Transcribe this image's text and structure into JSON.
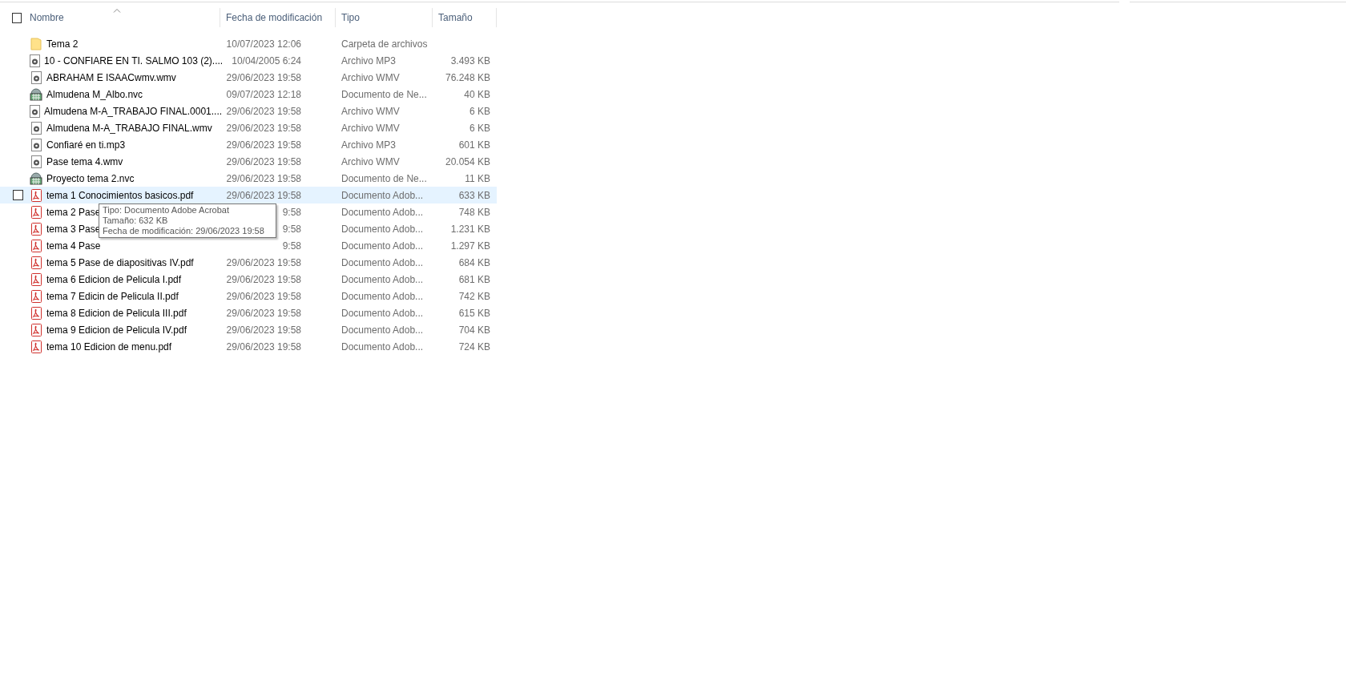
{
  "select_all": {
    "checked": false
  },
  "columns": [
    {
      "label": "Nombre",
      "sorted": true
    },
    {
      "label": "Fecha de modificación",
      "sorted": false
    },
    {
      "label": "Tipo",
      "sorted": false
    },
    {
      "label": "Tamaño",
      "sorted": false
    }
  ],
  "rows": [
    {
      "kind": "folder",
      "name": "Tema 2",
      "date": "10/07/2023 12:06",
      "type": "Carpeta de archivos",
      "hovered": false,
      "checked": false
    },
    {
      "kind": "media",
      "name": "10 - CONFIARE EN TI. SALMO 103 (2)....",
      "date": "10/04/2005 6:24",
      "type": "Archivo MP3",
      "size": "3.493 KB",
      "hovered": false,
      "checked": false
    },
    {
      "kind": "media",
      "name": "ABRAHAM E ISAACwmv.wmv",
      "date": "29/06/2023 19:58",
      "type": "Archivo WMV",
      "size": "76.248 KB",
      "hovered": false,
      "checked": false
    },
    {
      "kind": "project",
      "name": "Almudena M_Albo.nvc",
      "date": "09/07/2023 12:18",
      "type": "Documento de Ne...",
      "size": "40 KB",
      "hovered": false,
      "checked": false
    },
    {
      "kind": "media",
      "name": "Almudena M-A_TRABAJO FINAL.0001....",
      "date": "29/06/2023 19:58",
      "type": "Archivo WMV",
      "size": "6 KB",
      "hovered": false,
      "checked": false
    },
    {
      "kind": "media",
      "name": "Almudena M-A_TRABAJO FINAL.wmv",
      "date": "29/06/2023 19:58",
      "type": "Archivo WMV",
      "size": "6 KB",
      "hovered": false,
      "checked": false
    },
    {
      "kind": "media",
      "name": "Confiaré en ti.mp3",
      "date": "29/06/2023 19:58",
      "type": "Archivo MP3",
      "size": "601 KB",
      "hovered": false,
      "checked": false
    },
    {
      "kind": "media",
      "name": "Pase tema 4.wmv",
      "date": "29/06/2023 19:58",
      "type": "Archivo WMV",
      "size": "20.054 KB",
      "hovered": false,
      "checked": false
    },
    {
      "kind": "project",
      "name": "Proyecto tema 2.nvc",
      "date": "29/06/2023 19:58",
      "type": "Documento de Ne...",
      "size": "11 KB",
      "hovered": false,
      "checked": false
    },
    {
      "kind": "pdf",
      "name": "tema 1 Conocimientos basicos.pdf",
      "date": "29/06/2023 19:58",
      "type": "Documento Adob...",
      "size": "633 KB",
      "hovered": true,
      "checked": false
    },
    {
      "kind": "pdf",
      "name": "tema 2 Pase",
      "date": "9:58",
      "type": "Documento Adob...",
      "size": "748 KB",
      "hovered": false,
      "checked": false
    },
    {
      "kind": "pdf",
      "name": "tema 3 Pase",
      "date": "9:58",
      "type": "Documento Adob...",
      "size": "1.231 KB",
      "hovered": false,
      "checked": false
    },
    {
      "kind": "pdf",
      "name": "tema 4 Pase",
      "date": "9:58",
      "type": "Documento Adob...",
      "size": "1.297 KB",
      "hovered": false,
      "checked": false
    },
    {
      "kind": "pdf",
      "name": "tema 5 Pase de diapositivas IV.pdf",
      "date": "29/06/2023 19:58",
      "type": "Documento Adob...",
      "size": "684 KB",
      "hovered": false,
      "checked": false
    },
    {
      "kind": "pdf",
      "name": "tema 6 Edicion de Pelicula I.pdf",
      "date": "29/06/2023 19:58",
      "type": "Documento Adob...",
      "size": "681 KB",
      "hovered": false,
      "checked": false
    },
    {
      "kind": "pdf",
      "name": "tema 7 Edicin de Pelicula II.pdf",
      "date": "29/06/2023 19:58",
      "type": "Documento Adob...",
      "size": "742 KB",
      "hovered": false,
      "checked": false
    },
    {
      "kind": "pdf",
      "name": "tema 8 Edicion de Pelicula III.pdf",
      "date": "29/06/2023 19:58",
      "type": "Documento Adob...",
      "size": "615 KB",
      "hovered": false,
      "checked": false
    },
    {
      "kind": "pdf",
      "name": "tema 9 Edicion de Pelicula IV.pdf",
      "date": "29/06/2023 19:58",
      "type": "Documento Adob...",
      "size": "704 KB",
      "hovered": false,
      "checked": false
    },
    {
      "kind": "pdf",
      "name": "tema 10 Edicion de menu.pdf",
      "date": "29/06/2023 19:58",
      "type": "Documento Adob...",
      "size": "724 KB",
      "hovered": false,
      "checked": false
    }
  ],
  "tooltip": [
    "Tipo: Documento Adobe Acrobat",
    "Tamaño: 632 KB",
    "Fecha de modificación: 29/06/2023 19:58"
  ]
}
